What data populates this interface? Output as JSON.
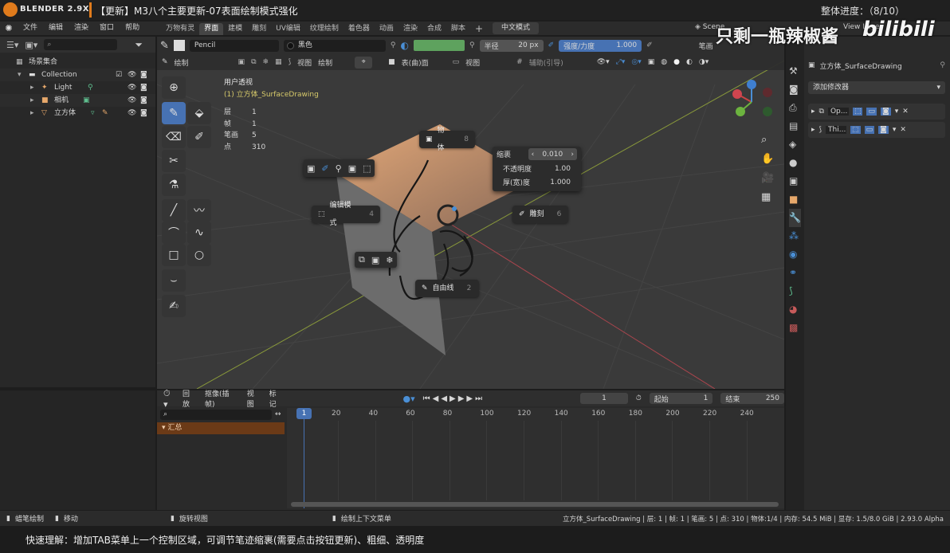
{
  "banner": {
    "app_version": "BLENDER 2.9X",
    "title": "【更新】M3八个主要更新-07表面绘制模式强化",
    "progress": "整体进度：（8/10）",
    "watermark": "只剩一瓶辣椒酱",
    "bilibili": "bilibili"
  },
  "menu": {
    "items": [
      "文件",
      "编辑",
      "渲染",
      "窗口",
      "帮助"
    ],
    "workspace_tabs": [
      "万物有灵",
      "界面",
      "建模",
      "雕刻",
      "UV编辑",
      "纹理绘制",
      "着色器",
      "动画",
      "渲染",
      "合成",
      "脚本"
    ],
    "active_tab": "界面",
    "language_btn": "中文模式",
    "scene": "Scene",
    "view_layer": "View Layer"
  },
  "outliner": {
    "scene_collection": "场景集合",
    "collection": "Collection",
    "items": [
      "Light",
      "相机",
      "立方体"
    ]
  },
  "tool_header": {
    "brush_name": "Pencil",
    "color_mode": "黑色",
    "radius_label": "半径",
    "radius_value": "20 px",
    "strength_label": "强度/力度",
    "strength_value": "1.000",
    "brush_menu": "笔画"
  },
  "viewport_header": {
    "mode": "绘制",
    "view": "视图",
    "draw": "绘制",
    "placement": "表(曲)面",
    "view2": "视图",
    "guides": "辅助(引导)"
  },
  "viewport": {
    "perspective": "用户透视",
    "object_name": "(1) 立方体_SurfaceDrawing",
    "stats": [
      {
        "label": "层",
        "value": "1"
      },
      {
        "label": "帧",
        "value": "1"
      },
      {
        "label": "笔画",
        "value": "5"
      },
      {
        "label": "点",
        "value": "310"
      }
    ]
  },
  "pie_menu": {
    "object": {
      "label": "物体",
      "num": "8"
    },
    "edit": {
      "label": "编辑模式",
      "num": "4"
    },
    "sculpt": {
      "label": "雕刻",
      "num": "6"
    },
    "freehand": {
      "label": "自由线",
      "num": "2"
    }
  },
  "popup": {
    "scale_label": "缩裹",
    "scale_value": "0.010",
    "opacity_label": "不透明度",
    "opacity_value": "1.00",
    "thickness_label": "厚(宽)度",
    "thickness_value": "1.000"
  },
  "properties": {
    "object_name": "立方体_SurfaceDrawing",
    "add_modifier": "添加修改器",
    "modifiers": [
      "Op...",
      "Thi..."
    ]
  },
  "timeline": {
    "playback": "回放",
    "keying": "抠像(插帧)",
    "view": "视图",
    "marker": "标记",
    "current_frame": "1",
    "start_label": "起始",
    "start_value": "1",
    "end_label": "结束",
    "end_value": "250",
    "ticks": [
      "1",
      "20",
      "40",
      "60",
      "80",
      "100",
      "120",
      "140",
      "160",
      "180",
      "200",
      "220",
      "240"
    ],
    "summary": "汇总"
  },
  "statusbar": {
    "left1": "蜡笔绘制",
    "left2": "移动",
    "mid1": "旋转视图",
    "mid2": "绘制上下文菜单",
    "info": "立方体_SurfaceDrawing | 层: 1 | 帧: 1 | 笔画: 5 | 点: 310 | 物体:1/4 | 内存: 54.5 MiB | 显存: 1.5/8.0 GiB | 2.93.0 Alpha"
  },
  "caption": {
    "text": "快速理解：增加TAB菜单上一个控制区域，可调节笔迹缩裹(需要点击按钮更新)、粗细、透明度"
  },
  "colors": {
    "accent_blue": "#4772b3",
    "orange": "#e07b1c",
    "green_bar": "#5cb85c"
  }
}
